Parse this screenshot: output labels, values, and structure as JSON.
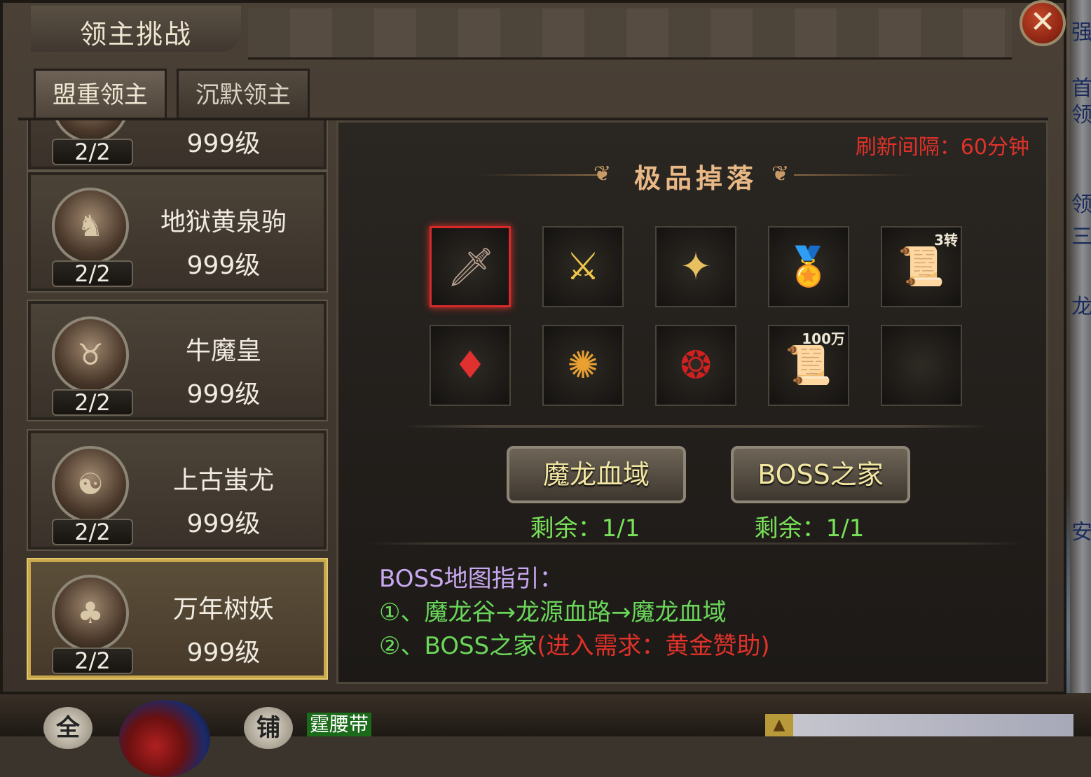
{
  "window": {
    "title": "领主挑战",
    "close_glyph": "✕"
  },
  "tabs": [
    {
      "label": "盟重领主",
      "active": true
    },
    {
      "label": "沉默领主",
      "active": false
    }
  ],
  "bosses": [
    {
      "name": "",
      "level": "999级",
      "count": "2/2",
      "icon": "boss-portrait-icon"
    },
    {
      "name": "地狱黄泉驹",
      "level": "999级",
      "count": "2/2",
      "icon": "demon-steed-icon"
    },
    {
      "name": "牛魔皇",
      "level": "999级",
      "count": "2/2",
      "icon": "bull-demon-icon"
    },
    {
      "name": "上古蚩尤",
      "level": "999级",
      "count": "2/2",
      "icon": "ancient-warrior-icon"
    },
    {
      "name": "万年树妖",
      "level": "999级",
      "count": "2/2",
      "icon": "tree-demon-icon",
      "selected": true
    }
  ],
  "panel": {
    "refresh": "刷新间隔：60分钟",
    "drop_title": "极品掉落",
    "items": [
      {
        "name": "dagger-icon",
        "glyph": "🗡",
        "rare": true,
        "qty": ""
      },
      {
        "name": "golden-weapon-icon",
        "glyph": "⚔",
        "rare": false,
        "qty": ""
      },
      {
        "name": "golden-armor-icon",
        "glyph": "✦",
        "rare": false,
        "qty": ""
      },
      {
        "name": "gold-medal-icon",
        "glyph": "🏅",
        "rare": false,
        "qty": ""
      },
      {
        "name": "scroll-icon",
        "glyph": "📜",
        "rare": false,
        "qty": "3转"
      },
      {
        "name": "red-crystal-icon",
        "glyph": "♦",
        "rare": false,
        "qty": ""
      },
      {
        "name": "golden-orb-icon",
        "glyph": "✺",
        "rare": false,
        "qty": ""
      },
      {
        "name": "red-rune-icon",
        "glyph": "❂",
        "rare": false,
        "qty": ""
      },
      {
        "name": "gold-scroll-icon",
        "glyph": "📜",
        "rare": false,
        "qty": "100万"
      },
      {
        "name": "empty-slot",
        "glyph": "",
        "rare": false,
        "qty": ""
      }
    ],
    "buttons": [
      {
        "label": "魔龙血域",
        "remain": "剩余：1/1"
      },
      {
        "label": "BOSS之家",
        "remain": "剩余：1/1"
      }
    ],
    "guide": {
      "title": "BOSS地图指引：",
      "line1": "①、魔龙谷→龙源血路→魔龙血域",
      "line2_main": "②、BOSS之家",
      "line2_req": "(进入需求：黄金赞助)"
    }
  },
  "background": {
    "right_strip": [
      "强",
      "首",
      "领",
      "领",
      "三",
      "龙",
      "安"
    ],
    "bottom_badges": [
      "全",
      "铺"
    ],
    "bottom_tag": "霆腰带"
  },
  "colors": {
    "refresh_red": "#e0322a",
    "remain_green": "#7ae05a",
    "guide_purple": "#c8a8f0",
    "guide_green": "#6ad65a",
    "button_yellow": "#f1e6a2",
    "selected_gold": "#e4c76a"
  }
}
